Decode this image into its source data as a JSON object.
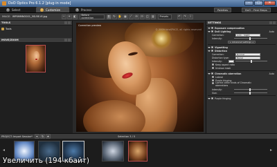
{
  "window": {
    "title": "DxO Optics Pro 6.1.2 [plug-in mode]",
    "minimize": "–",
    "maximize": "□",
    "close": "✕"
  },
  "tabs": [
    {
      "num": "1",
      "label": "Select"
    },
    {
      "num": "2",
      "label": "Customize"
    },
    {
      "num": "3",
      "label": "Process"
    }
  ],
  "top_buttons": {
    "palettes": "Palettes",
    "first_steps": "DxO - First Steps"
  },
  "toolbar": {
    "image_label": "IMAGE:",
    "image_name": "IMP0MMNO001_5SU5E.ifl.jpg",
    "before_correction": "Before correction",
    "presets": "Presets"
  },
  "left_panel": {
    "tools_header": "TOOLS",
    "tools_item": "Tools",
    "navigator_header": "MOVE/ZOOM"
  },
  "center": {
    "label": "Correction preview",
    "watermark": "© 2009 fotoSPACE, all rights reserved"
  },
  "settings": {
    "header": "SETTINGS",
    "exposure": "Exposure compensation",
    "lighting": "DxO Lighting",
    "auto": "Auto",
    "correction_label": "Correction:",
    "correction_value": "Auto - Slight",
    "intensity_label": "Intensity:",
    "advanced": "+ Advanced settings +",
    "vignetting": "Vignetting",
    "distortion": "Distortion",
    "distortion_value": "Normal",
    "distortion_type": "Distortion type:",
    "distortion_type_value": "Barrel",
    "keep_aspect": "Keep aspect ratio",
    "unshow": "Unshow mask",
    "chromatic": "Chromatic aberration",
    "lateral": "Lateral",
    "purple": "Purple fringing",
    "correct_other": "Correct other kinds of Chromatic aberrations",
    "size": "Size:",
    "purple_fringing": "Purple fringing"
  },
  "bottom": {
    "project": "PROJECT: Import Session*",
    "selection": "Selection 3 / 5"
  },
  "caption": "Увеличить (194 кбайт)"
}
